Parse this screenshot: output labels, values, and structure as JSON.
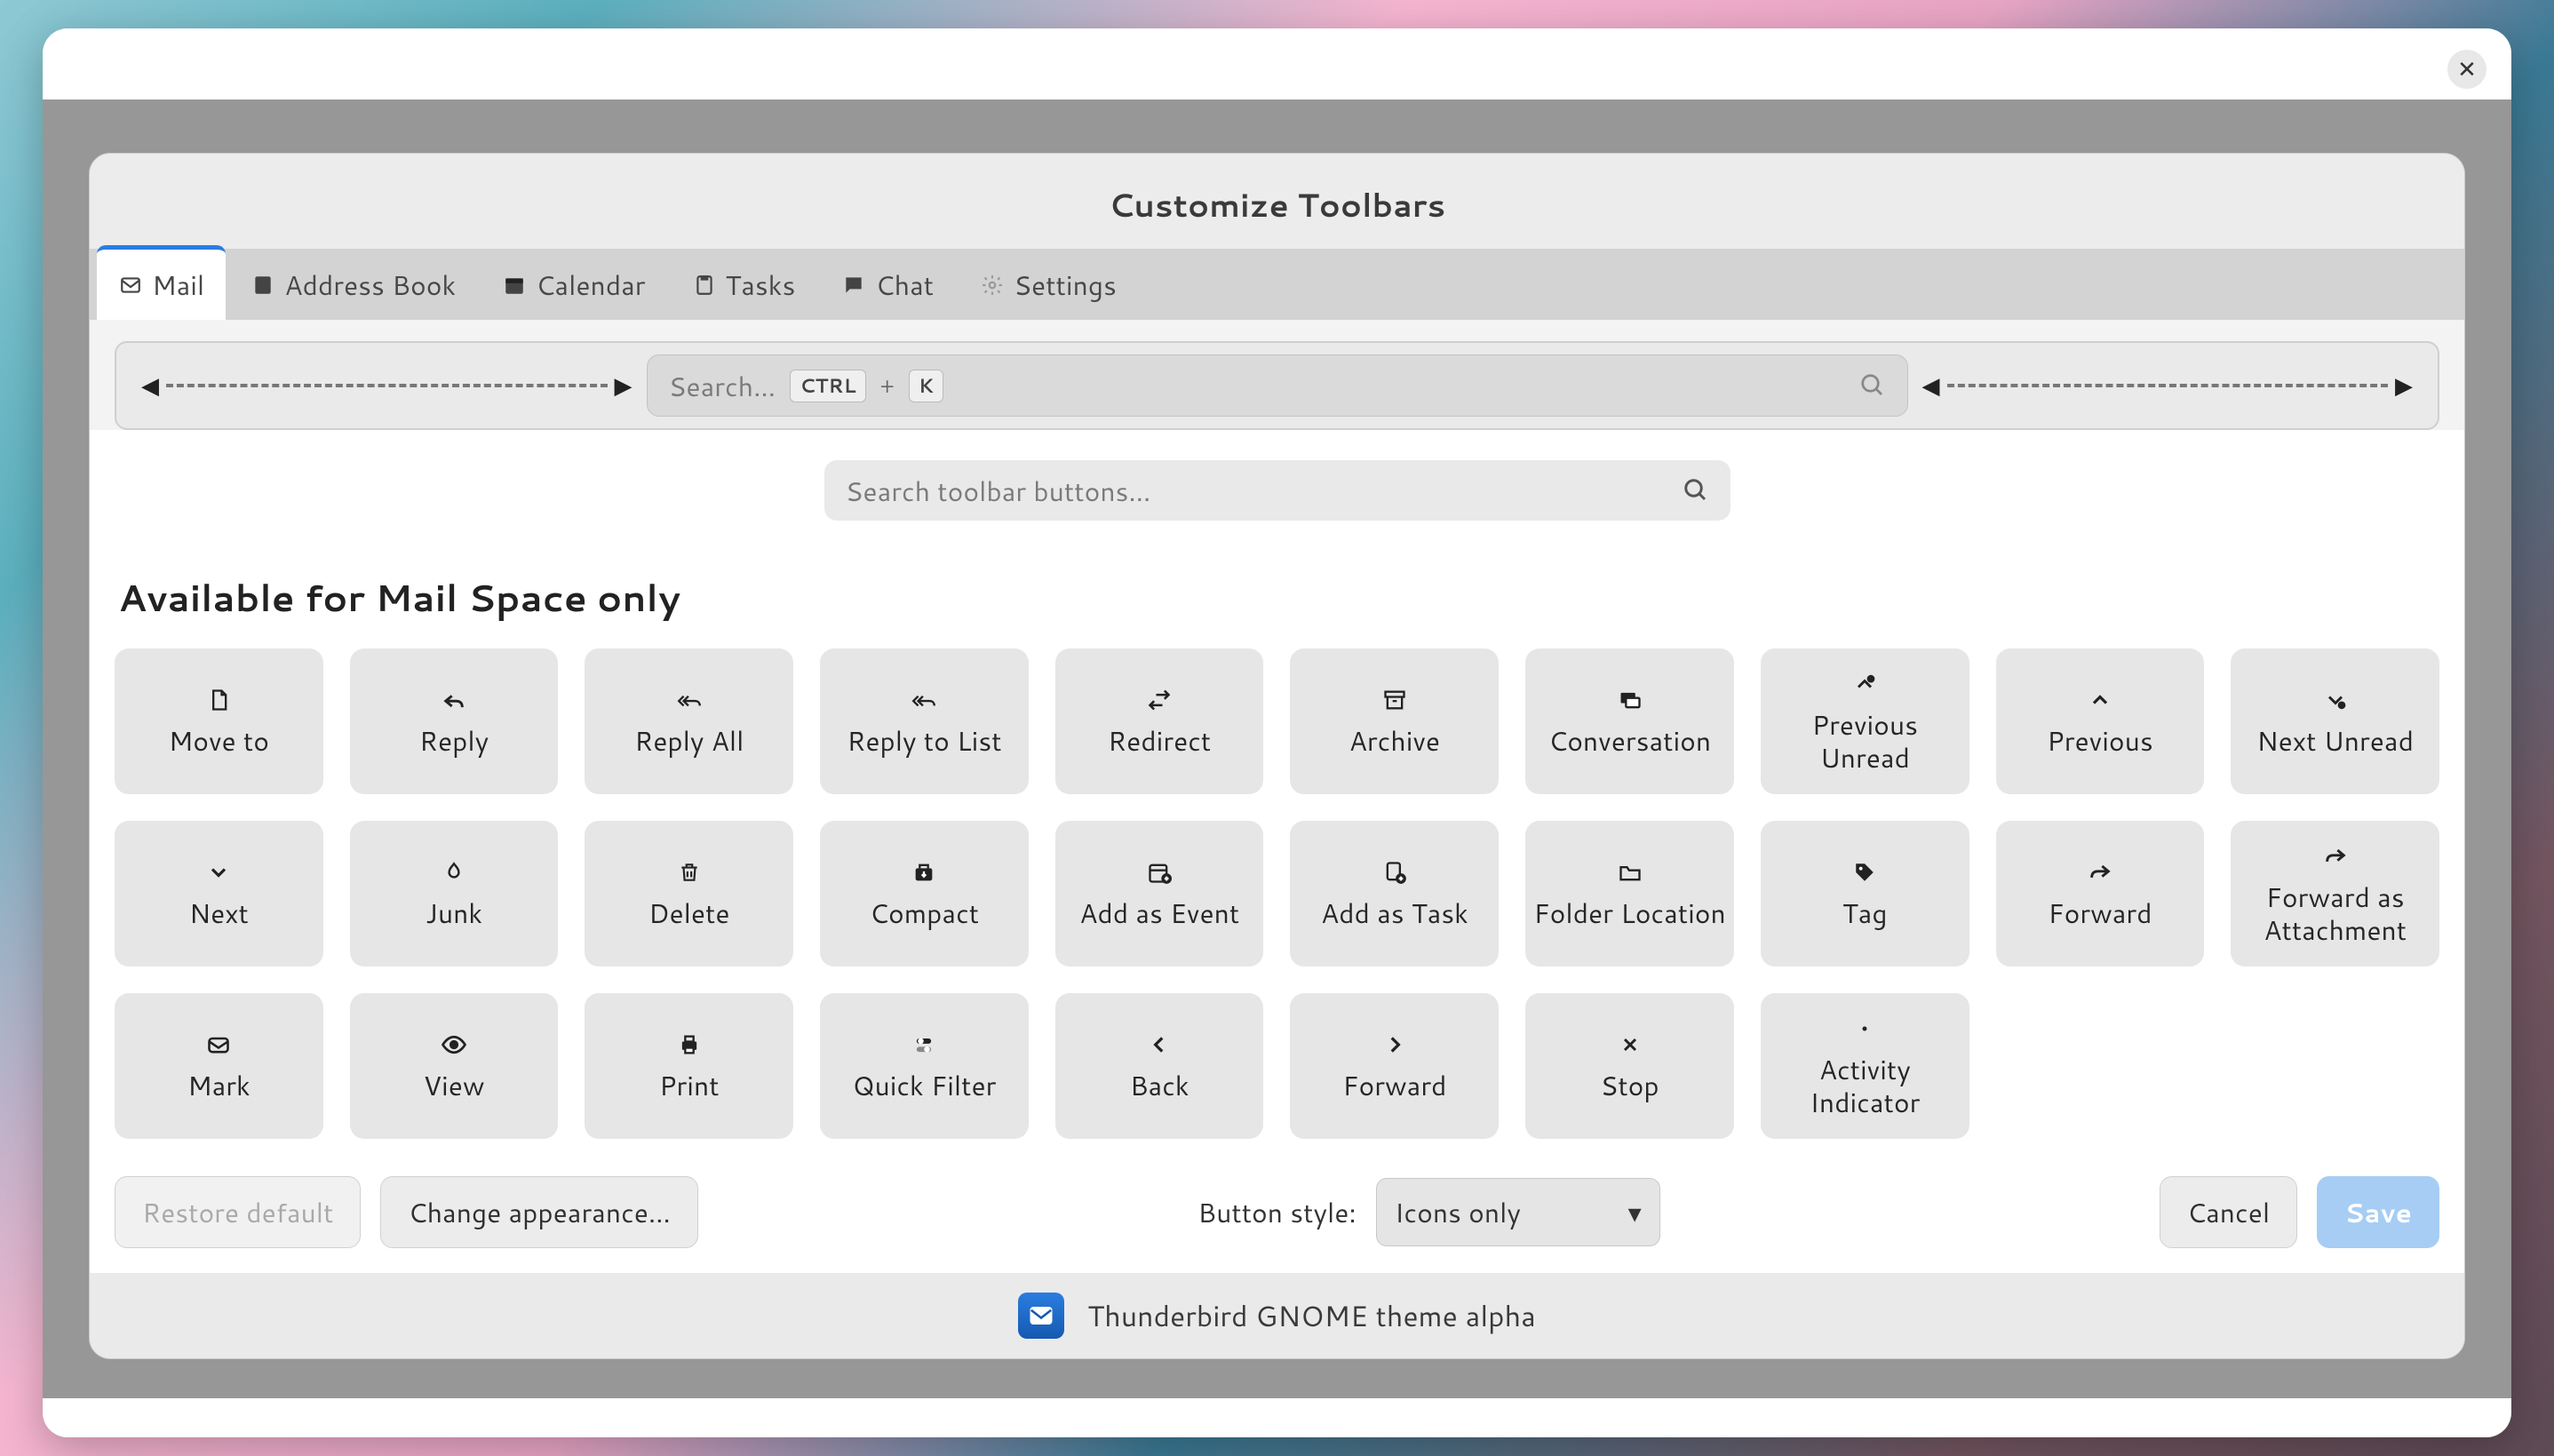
{
  "dialog": {
    "title": "Customize Toolbars"
  },
  "tabs": [
    {
      "label": "Mail",
      "icon": "mail-icon",
      "active": true
    },
    {
      "label": "Address Book",
      "icon": "addressbook-icon",
      "active": false
    },
    {
      "label": "Calendar",
      "icon": "calendar-icon",
      "active": false
    },
    {
      "label": "Tasks",
      "icon": "tasks-icon",
      "active": false
    },
    {
      "label": "Chat",
      "icon": "chat-icon",
      "active": false
    },
    {
      "label": "Settings",
      "icon": "settings-icon",
      "active": false
    }
  ],
  "toolbar_preview": {
    "search_placeholder": "Search…",
    "shortcut_keys": [
      "CTRL",
      "K"
    ]
  },
  "filter": {
    "placeholder": "Search toolbar buttons…"
  },
  "section_heading": "Available for Mail Space only",
  "buttons": [
    {
      "label": "Move to",
      "icon": "file-icon"
    },
    {
      "label": "Reply",
      "icon": "reply-icon"
    },
    {
      "label": "Reply All",
      "icon": "reply-all-icon"
    },
    {
      "label": "Reply to List",
      "icon": "reply-list-icon"
    },
    {
      "label": "Redirect",
      "icon": "redirect-icon"
    },
    {
      "label": "Archive",
      "icon": "archive-icon"
    },
    {
      "label": "Conversation",
      "icon": "conversation-icon"
    },
    {
      "label": "Previous Unread",
      "icon": "prev-unread-icon"
    },
    {
      "label": "Previous",
      "icon": "previous-icon"
    },
    {
      "label": "Next Unread",
      "icon": "next-unread-icon"
    },
    {
      "label": "Next",
      "icon": "next-icon"
    },
    {
      "label": "Junk",
      "icon": "junk-icon"
    },
    {
      "label": "Delete",
      "icon": "delete-icon"
    },
    {
      "label": "Compact",
      "icon": "compact-icon"
    },
    {
      "label": "Add as Event",
      "icon": "add-event-icon"
    },
    {
      "label": "Add as Task",
      "icon": "add-task-icon"
    },
    {
      "label": "Folder Location",
      "icon": "folder-icon"
    },
    {
      "label": "Tag",
      "icon": "tag-icon"
    },
    {
      "label": "Forward",
      "icon": "forward-icon"
    },
    {
      "label": "Forward as Attachment",
      "icon": "forward-attach-icon"
    },
    {
      "label": "Mark",
      "icon": "mark-icon"
    },
    {
      "label": "View",
      "icon": "view-icon"
    },
    {
      "label": "Print",
      "icon": "print-icon"
    },
    {
      "label": "Quick Filter",
      "icon": "quickfilter-icon"
    },
    {
      "label": "Back",
      "icon": "back-icon"
    },
    {
      "label": "Forward",
      "icon": "nav-forward-icon"
    },
    {
      "label": "Stop",
      "icon": "stop-icon"
    },
    {
      "label": "Activity Indicator",
      "icon": "activity-icon"
    }
  ],
  "footer": {
    "restore": "Restore default",
    "change_appearance": "Change appearance…",
    "style_label": "Button style:",
    "style_value": "Icons only",
    "cancel": "Cancel",
    "save": "Save"
  },
  "bottom": {
    "text": "Thunderbird GNOME theme alpha"
  }
}
